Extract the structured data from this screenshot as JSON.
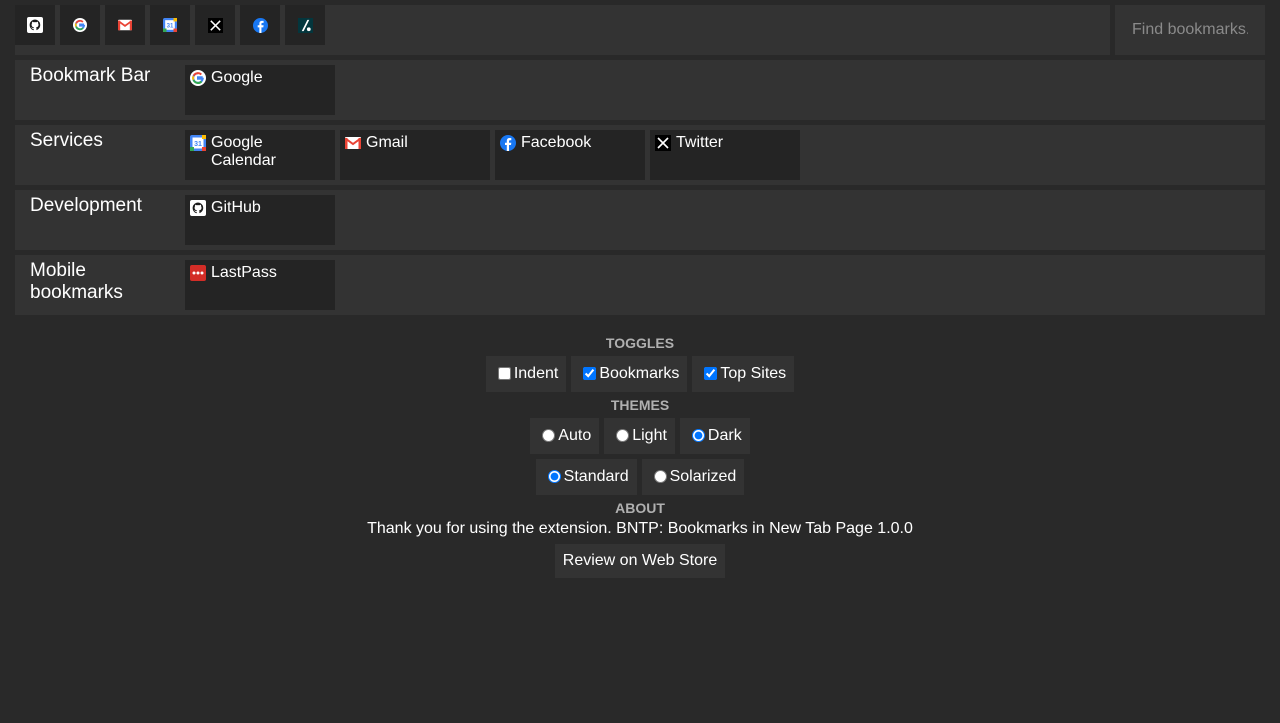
{
  "search": {
    "placeholder": "Find bookmarks..."
  },
  "top_sites": [
    {
      "name": "GitHub",
      "icon": "github-icon"
    },
    {
      "name": "Google",
      "icon": "google-icon"
    },
    {
      "name": "Gmail",
      "icon": "gmail-icon"
    },
    {
      "name": "Google Calendar",
      "icon": "calendar-icon"
    },
    {
      "name": "Twitter",
      "icon": "x-icon"
    },
    {
      "name": "Facebook",
      "icon": "facebook-icon"
    },
    {
      "name": "Zendesk",
      "icon": "zendesk-icon"
    }
  ],
  "folders": [
    {
      "name": "Bookmark Bar",
      "items": [
        {
          "label": "Google",
          "icon": "google-icon"
        }
      ]
    },
    {
      "name": "Services",
      "items": [
        {
          "label": "Google Calendar",
          "icon": "calendar-icon"
        },
        {
          "label": "Gmail",
          "icon": "gmail-icon"
        },
        {
          "label": "Facebook",
          "icon": "facebook-icon"
        },
        {
          "label": "Twitter",
          "icon": "x-icon"
        }
      ]
    },
    {
      "name": "Development",
      "items": [
        {
          "label": "GitHub",
          "icon": "github-icon"
        }
      ]
    },
    {
      "name": "Mobile bookmarks",
      "items": [
        {
          "label": "LastPass",
          "icon": "lastpass-icon"
        }
      ]
    }
  ],
  "toggles": {
    "title": "TOGGLES",
    "items": [
      {
        "label": "Indent",
        "checked": false
      },
      {
        "label": "Bookmarks",
        "checked": true
      },
      {
        "label": "Top Sites",
        "checked": true
      }
    ]
  },
  "themes": {
    "title": "THEMES",
    "modes": [
      {
        "label": "Auto",
        "checked": false
      },
      {
        "label": "Light",
        "checked": false
      },
      {
        "label": "Dark",
        "checked": true
      }
    ],
    "styles": [
      {
        "label": "Standard",
        "checked": true
      },
      {
        "label": "Solarized",
        "checked": false
      }
    ]
  },
  "about": {
    "title": "ABOUT",
    "text": "Thank you for using the extension. BNTP: Bookmarks in New Tab Page 1.0.0",
    "review_label": "Review on Web Store"
  },
  "colors": {
    "background": "#292929",
    "panel": "#333333",
    "tile": "#242424",
    "accent": "#1a73e8"
  }
}
